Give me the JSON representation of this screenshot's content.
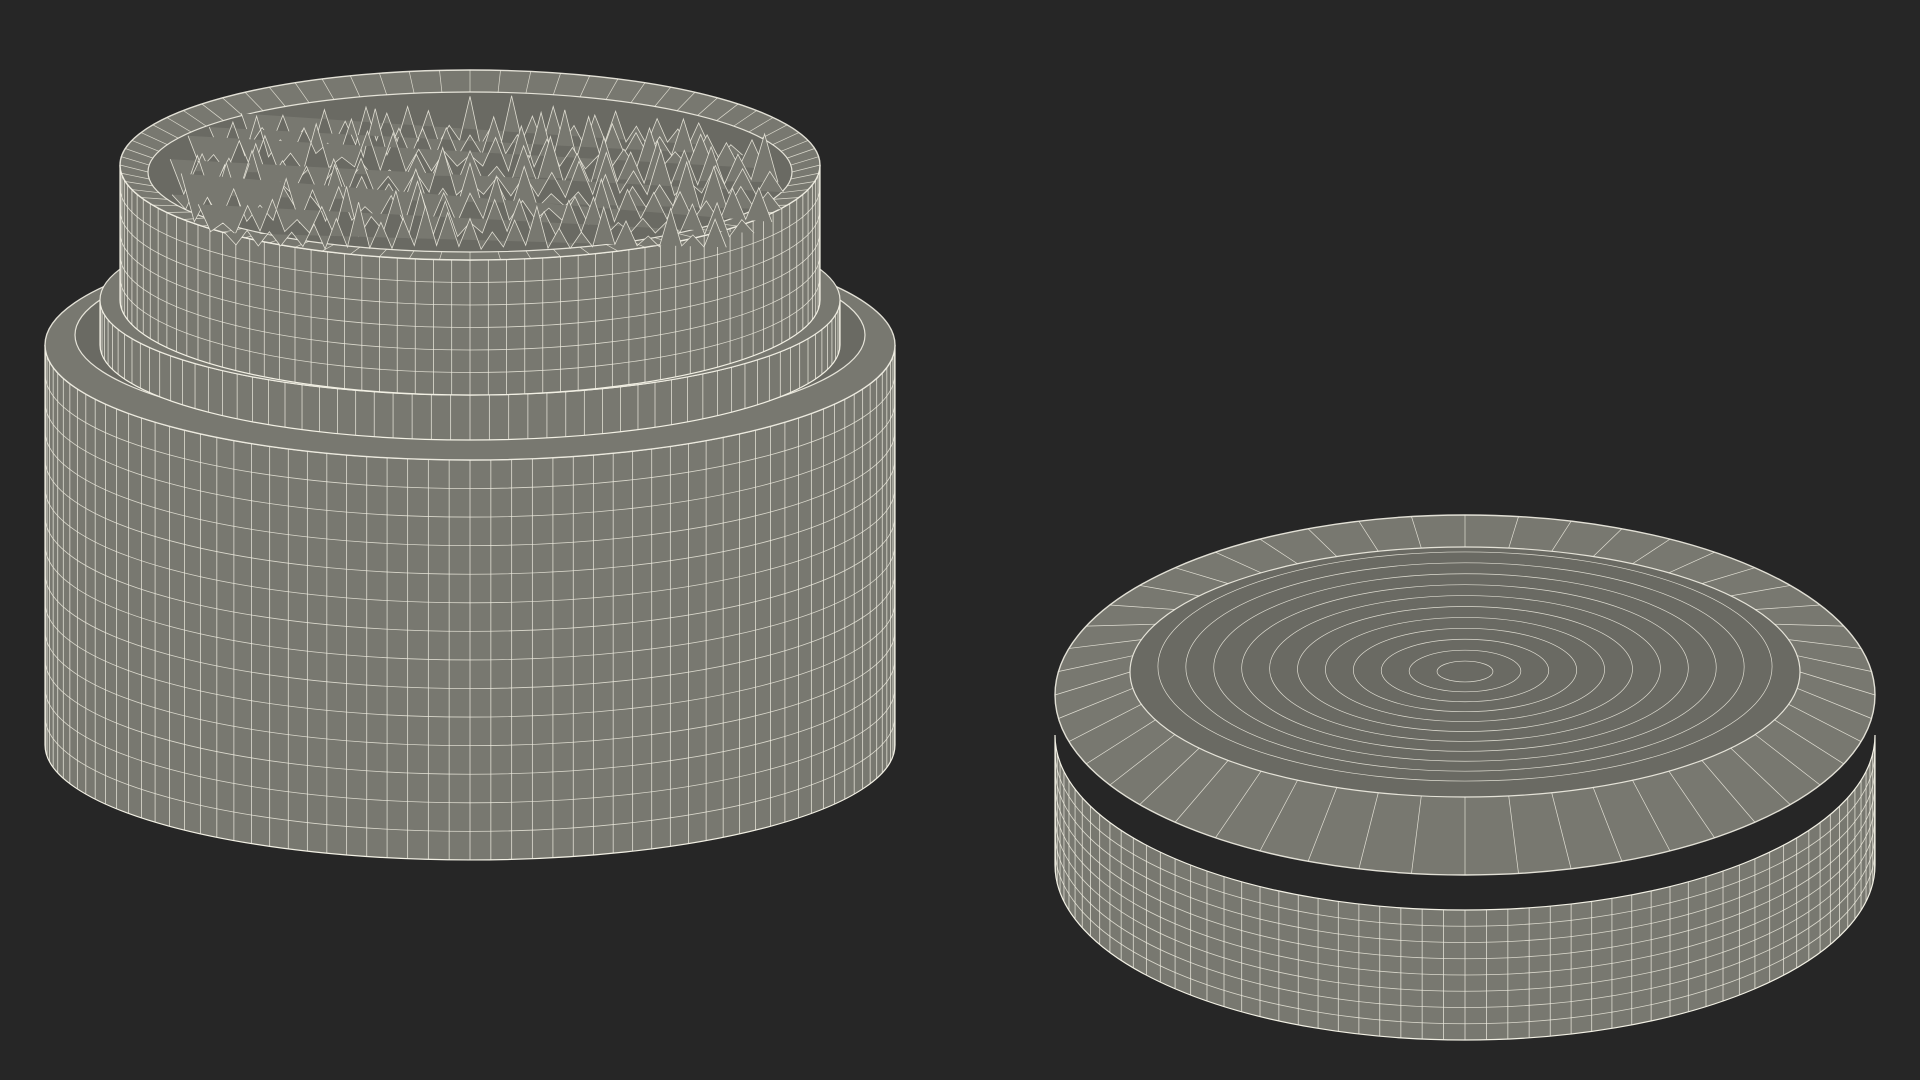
{
  "scene": {
    "subject": "wireframe-render",
    "background_color": "#262626",
    "surface_color": "#787870",
    "surface_dark_color": "#6a6a63",
    "wire_color": "#f2f0e4",
    "objects": [
      {
        "name": "cosmetic-jar-body",
        "has_content_inside": true
      },
      {
        "name": "cosmetic-jar-lid"
      }
    ]
  }
}
